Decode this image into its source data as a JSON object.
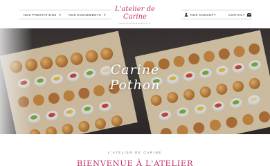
{
  "brand": {
    "logo_script": "L'atelier de Carine",
    "logo_sub": "www.latelierdecarine.fr",
    "accent": "#c0356a"
  },
  "nav_left": [
    {
      "label": "NOS PRESTATIONS",
      "icon": "chevron-down-icon"
    },
    {
      "label": "NOS EVENEMENTS",
      "icon": "chevron-down-icon"
    }
  ],
  "nav_right": [
    {
      "label": "NOS CONCEPT",
      "icon": "user-icon"
    },
    {
      "label": "CONTACT",
      "icon": "mail-icon"
    }
  ],
  "hero": {
    "title": "Carine Pothon"
  },
  "intro": {
    "kicker": "L'ATELIER DE CARINE",
    "welcome": "BIENVENUE À L'ATELIER"
  }
}
